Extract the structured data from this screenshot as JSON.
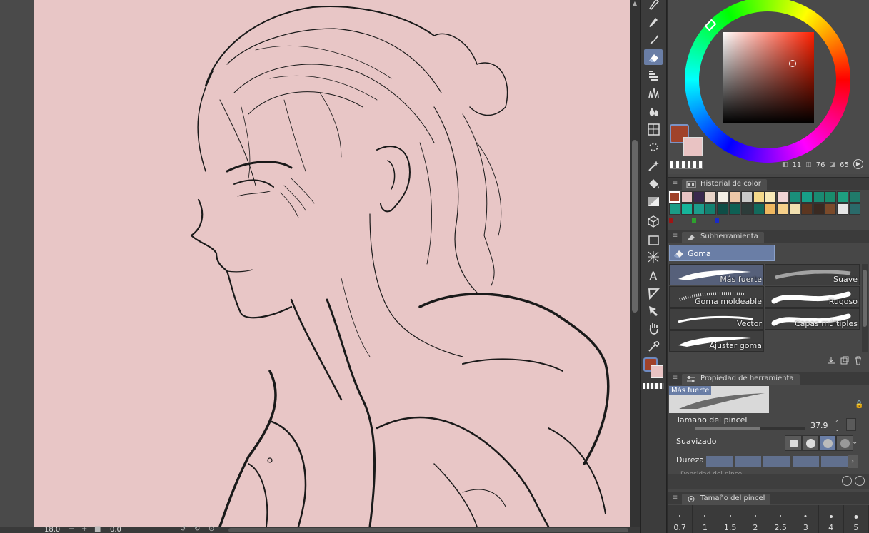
{
  "statusbar": {
    "zoom": "18.0",
    "rotation": "0.0"
  },
  "toolbar": {
    "tools": [
      {
        "name": "pen-tool-icon",
        "active": false
      },
      {
        "name": "pencil-tool-icon",
        "active": false
      },
      {
        "name": "brush-tool-icon",
        "active": false
      },
      {
        "name": "eraser-tool-icon",
        "active": true
      },
      {
        "name": "decoration-tool-icon",
        "active": false
      },
      {
        "name": "grass-brush-icon",
        "active": false
      },
      {
        "name": "blend-tool-icon",
        "active": false
      },
      {
        "name": "grid-frame-icon",
        "active": false
      },
      {
        "name": "lasso-select-icon",
        "active": false
      },
      {
        "name": "magic-wand-icon",
        "active": false
      },
      {
        "name": "fill-bucket-icon",
        "active": false
      },
      {
        "name": "gradient-icon",
        "active": false
      },
      {
        "name": "3d-object-icon",
        "active": false
      },
      {
        "name": "rectangle-icon",
        "active": false
      },
      {
        "name": "effect-lines-icon",
        "active": false
      },
      {
        "name": "text-tool-icon",
        "active": false
      },
      {
        "name": "ruler-tool-icon",
        "active": false
      },
      {
        "name": "operation-tool-icon",
        "active": false
      },
      {
        "name": "hand-tool-icon",
        "active": false
      },
      {
        "name": "eyedropper-icon",
        "active": false
      }
    ],
    "main_color": "#a0422a",
    "sub_color": "#e9c3c3"
  },
  "color_wheel": {
    "main_color": "#a0422a",
    "sub_color": "#e9c3c3",
    "values": {
      "h": "11",
      "s": "76",
      "v": "65"
    }
  },
  "color_history": {
    "title": "Historial de color",
    "row1": [
      "#a0422a",
      "#e9c3c3",
      "#3a2a4e",
      "#e8d4c8",
      "#f4efe6",
      "#eec8a8",
      "#c9c9c9",
      "#f5d98a",
      "#f9eab8",
      "#f3d6d6",
      "#1a8f7a",
      "#17a088",
      "#1a8a72",
      "#198c6c",
      "#1e9f80",
      "#207a6a"
    ],
    "row2": [
      "#1a9c86",
      "#16b49a",
      "#1c9d8c",
      "#138070",
      "#0f4d46",
      "#0e6054",
      "#2c3c3a",
      "#136a5c",
      "#f0b860",
      "#f6d08a",
      "#f2e0b0",
      "#5c3620",
      "#3a2a22",
      "#7a4a2a",
      "#e6e6e6",
      "#2a6a6a"
    ],
    "dots": [
      "#a01414",
      "#2ea22e",
      "#1a2ac8"
    ]
  },
  "subtool": {
    "title": "Subherramienta",
    "group": "Goma",
    "brushes": [
      {
        "label": "Más fuerte",
        "selected": true
      },
      {
        "label": "Suave",
        "selected": false
      },
      {
        "label": "Goma moldeable",
        "selected": false
      },
      {
        "label": "Rugoso",
        "selected": false
      },
      {
        "label": "Vector",
        "selected": false
      },
      {
        "label": "Capas múltiples",
        "selected": false
      },
      {
        "label": "Ajustar goma",
        "selected": false
      }
    ]
  },
  "tool_property": {
    "title": "Propiedad de herramienta",
    "preview_label": "Más fuerte",
    "brush_size_label": "Tamaño del pincel",
    "brush_size_value": "37.9",
    "brush_size_fraction": 0.6,
    "antialias_label": "Suavizado",
    "hardness_label": "Dureza",
    "cut_label": "Densidad del pincel"
  },
  "brush_size_panel": {
    "title": "Tamaño del pincel",
    "sizes": [
      "0.7",
      "1",
      "1.5",
      "2",
      "2.5",
      "3",
      "4",
      "5"
    ]
  }
}
